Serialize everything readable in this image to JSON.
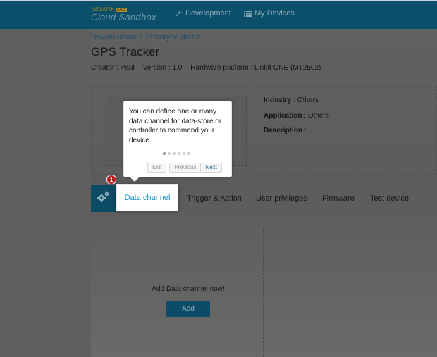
{
  "topbar": {
    "logo_small": "MEDIATEK",
    "logo_badge": "LAB",
    "logo_main": "Cloud Sandbox",
    "nav": [
      {
        "label": "Development",
        "icon": "wrench-icon"
      },
      {
        "label": "My Devices",
        "icon": "list-icon"
      }
    ]
  },
  "breadcrumb": {
    "parent": "Development",
    "separator": ">",
    "current": "Prototype detail"
  },
  "prototype": {
    "title": "GPS Tracker",
    "creator": "Creator : Paul",
    "version": "Version : 1.0",
    "platform": "Hardware platform : LinkIt ONE (MT2502)",
    "industry_label": "Industry",
    "industry_value": " : Others",
    "application_label": "Application",
    "application_value": " : Others",
    "description_label": "Description",
    "description_value": " :"
  },
  "tabs": {
    "active": "Data channel",
    "items": [
      "Trigger & Action",
      "User privileges",
      "Firmware",
      "Test device"
    ]
  },
  "step_badge": "1",
  "tooltip": {
    "text": "You can define one or many data channel for data-store or controller to command your device.",
    "dots_total": 6,
    "dots_active": 1,
    "exit": "Exit",
    "previous": "Previous",
    "next": "Next"
  },
  "data_channel": {
    "prompt": "Add Data channel now!",
    "add_label": "Add"
  },
  "colors": {
    "topbar": "#0b4f6a",
    "accent": "#1a8fc7",
    "badge": "#b41d1d"
  }
}
